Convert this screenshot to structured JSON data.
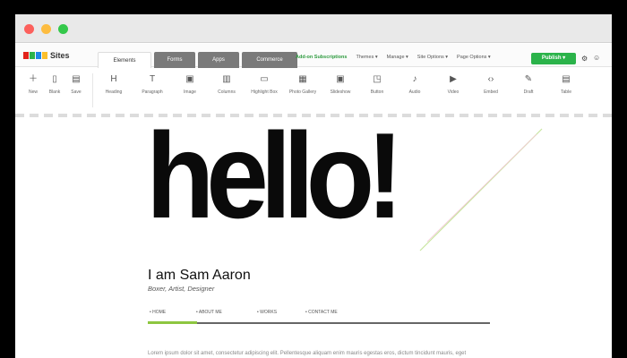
{
  "window": {
    "controls": [
      "close",
      "minimize",
      "maximize"
    ]
  },
  "app": {
    "logo_text": "Sites",
    "logo_colors": [
      "#e2231a",
      "#2bb34a",
      "#1e88e5",
      "#fbc02d"
    ]
  },
  "tabs": [
    {
      "label": "Elements",
      "active": true
    },
    {
      "label": "Forms",
      "active": false
    },
    {
      "label": "Apps",
      "active": false
    },
    {
      "label": "Commerce",
      "active": false
    }
  ],
  "menu": {
    "subscription": "Add-on Subscriptions",
    "themes": "Themes ▾",
    "manage": "Manage ▾",
    "site_options": "Site Options ▾",
    "page_options": "Page Options ▾"
  },
  "publish_label": "Publish ▾",
  "toolbar": {
    "left": [
      {
        "label": "New",
        "icon": "plus-icon"
      },
      {
        "label": "Blank",
        "icon": "page-icon"
      },
      {
        "label": "Save",
        "icon": "save-icon"
      }
    ],
    "elements": [
      {
        "label": "Heading",
        "icon": "heading-icon"
      },
      {
        "label": "Paragraph",
        "icon": "paragraph-icon"
      },
      {
        "label": "Image",
        "icon": "image-icon"
      },
      {
        "label": "Columns",
        "icon": "columns-icon"
      },
      {
        "label": "Highlight Box",
        "icon": "highlight-box-icon"
      },
      {
        "label": "Photo Gallery",
        "icon": "photo-gallery-icon"
      },
      {
        "label": "Slideshow",
        "icon": "slideshow-icon"
      },
      {
        "label": "Button",
        "icon": "button-icon"
      },
      {
        "label": "Audio",
        "icon": "audio-icon"
      },
      {
        "label": "Video",
        "icon": "video-icon"
      },
      {
        "label": "Embed",
        "icon": "embed-icon"
      },
      {
        "label": "Draft",
        "icon": "pencil-icon"
      },
      {
        "label": "Table",
        "icon": "table-icon"
      }
    ]
  },
  "page": {
    "headline": "hello!",
    "name": "I am Sam Aaron",
    "role": "Boxer, Artist, Designer",
    "nav": [
      "• HOME",
      "• ABOUT ME",
      "• WORKS",
      "• CONTACT ME"
    ],
    "body": "Lorem ipsum dolor sit amet, consectetur adipiscing elit. Pellentesque aliquam enim mauris egestas eros, dictum tincidunt mauris, eget congue tellus. Maecenas fermentum sagittis vel."
  },
  "colors": {
    "accent_green": "#2bb34a",
    "nav_active": "#8dc63f"
  }
}
